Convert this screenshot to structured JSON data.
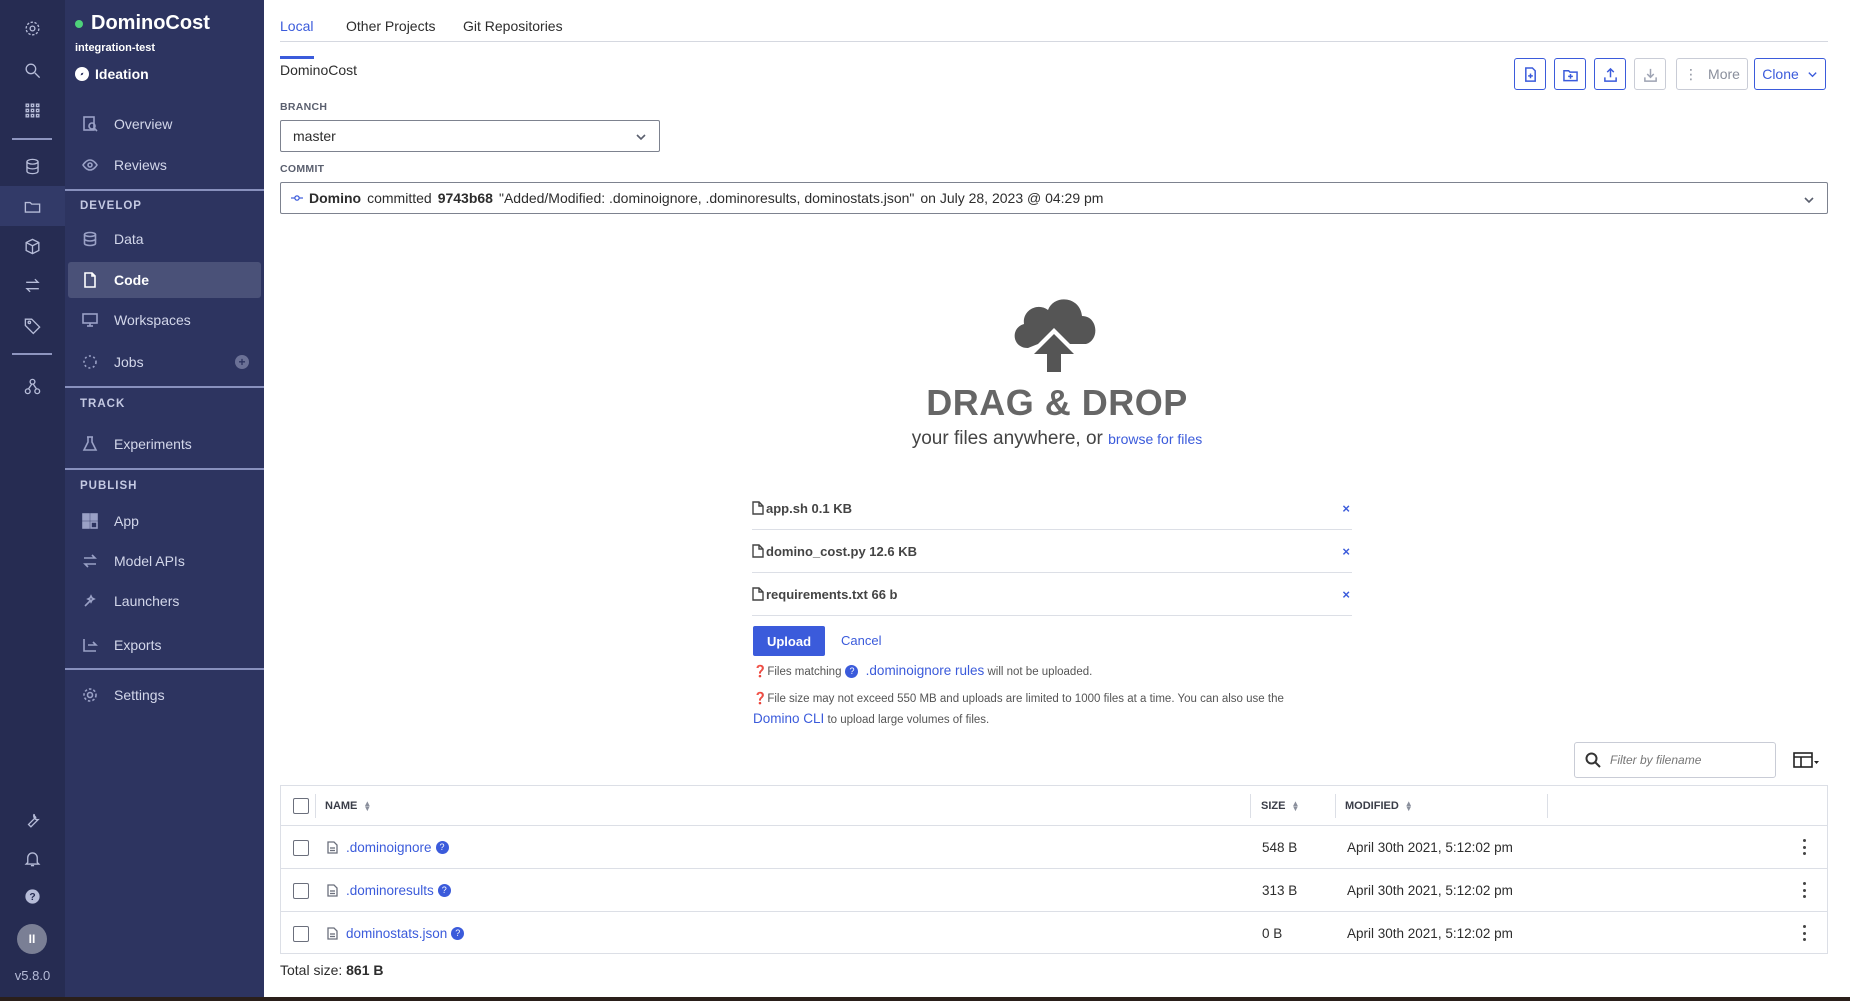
{
  "app": {
    "version": "v5.8.0",
    "avatar_initials": "II"
  },
  "project": {
    "name": "DominoCost",
    "owner": "integration-test",
    "stage": "Ideation"
  },
  "nav": {
    "overview": "Overview",
    "reviews": "Reviews",
    "develop_section": "DEVELOP",
    "data": "Data",
    "code": "Code",
    "workspaces": "Workspaces",
    "jobs": "Jobs",
    "track_section": "TRACK",
    "experiments": "Experiments",
    "publish_section": "PUBLISH",
    "app": "App",
    "model_apis": "Model APIs",
    "launchers": "Launchers",
    "exports": "Exports",
    "settings": "Settings"
  },
  "tabs": {
    "local": "Local",
    "other_projects": "Other Projects",
    "git_repositories": "Git Repositories"
  },
  "repo": {
    "name": "DominoCost"
  },
  "toolbar": {
    "more": "More",
    "clone": "Clone"
  },
  "branch": {
    "label": "BRANCH",
    "value": "master"
  },
  "commit": {
    "label": "COMMIT",
    "author": "Domino",
    "verb": "committed",
    "hash": "9743b68",
    "message": "\"Added/Modified: .dominoignore, .dominoresults, dominostats.json\"",
    "date": "on July 28, 2023 @ 04:29 pm"
  },
  "dropzone": {
    "title": "DRAG & DROP",
    "subtitle": "your files anywhere, or",
    "browse": "browse for files"
  },
  "pending_files": [
    {
      "name": "app.sh 0.1 KB"
    },
    {
      "name": "domino_cost.py 12.6 KB"
    },
    {
      "name": "requirements.txt 66 b"
    }
  ],
  "upload": {
    "upload_label": "Upload",
    "cancel_label": "Cancel",
    "note1_prefix": "Files matching",
    "note1_link": ".dominoignore rules",
    "note1_suffix": "will not be uploaded.",
    "note2": "File size may not exceed 550 MB and uploads are limited to 1000 files at a time. You can also use the",
    "note2_link": "Domino CLI",
    "note2_suffix": "to upload large volumes of files."
  },
  "filter": {
    "placeholder": "Filter by filename"
  },
  "table": {
    "headers": {
      "name": "NAME",
      "size": "SIZE",
      "modified": "MODIFIED"
    },
    "rows": [
      {
        "name": ".dominoignore",
        "size": "548 B",
        "modified": "April 30th 2021, 5:12:02 pm"
      },
      {
        "name": ".dominoresults",
        "size": "313 B",
        "modified": "April 30th 2021, 5:12:02 pm"
      },
      {
        "name": "dominostats.json",
        "size": "0 B",
        "modified": "April 30th 2021, 5:12:02 pm"
      }
    ]
  },
  "total": {
    "label": "Total size:",
    "value": "861 B"
  },
  "colors": {
    "accent": "#3b5bdb",
    "rail": "#262c52",
    "nav": "#2d3460"
  }
}
